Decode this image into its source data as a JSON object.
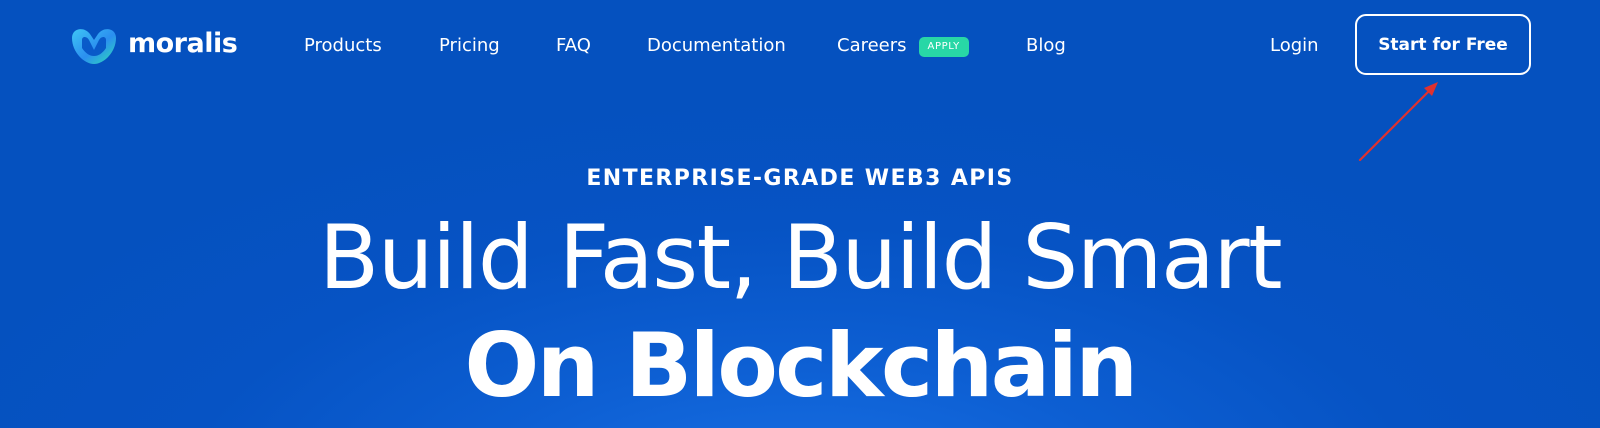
{
  "brand": {
    "name": "moralis",
    "logo_colors": [
      "#3ec6f5",
      "#2b8ff0",
      "#2fe0b4"
    ]
  },
  "nav": {
    "items": [
      {
        "label": "Products"
      },
      {
        "label": "Pricing"
      },
      {
        "label": "FAQ"
      },
      {
        "label": "Documentation"
      },
      {
        "label": "Careers",
        "badge": "APPLY"
      },
      {
        "label": "Blog"
      }
    ],
    "login_label": "Login",
    "cta_label": "Start for Free"
  },
  "hero": {
    "eyebrow": "ENTERPRISE-GRADE WEB3 APIS",
    "headline_line1": "Build Fast, Build Smart",
    "headline_line2": "On Blockchain"
  },
  "colors": {
    "background": "#0653c4",
    "badge": "#28d7a6",
    "annotation_arrow": "#e0312f",
    "text": "#ffffff"
  },
  "annotation": {
    "icon": "red-arrow-icon"
  }
}
